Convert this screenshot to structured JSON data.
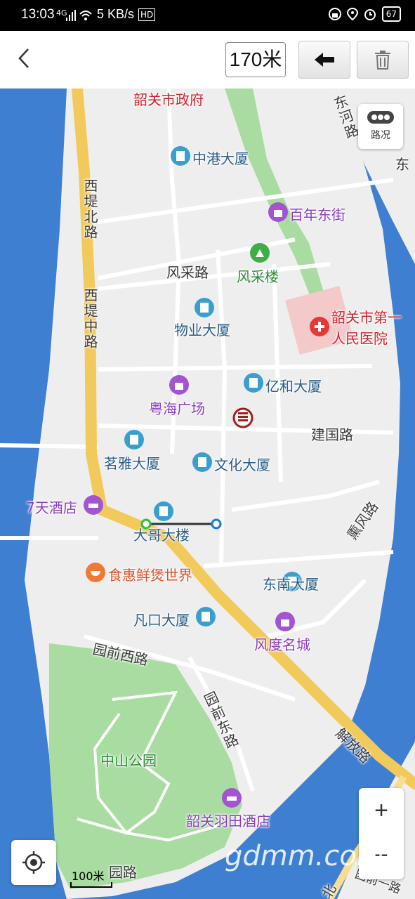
{
  "status_bar": {
    "time": "13:03",
    "network": "4G",
    "speed": "5 KB/s",
    "hd": "HD",
    "battery": "67"
  },
  "toolbar": {
    "distance": "170米"
  },
  "map_controls": {
    "traffic_label": "路况",
    "zoom_in": "+",
    "zoom_out": "−",
    "scale": "100米"
  },
  "watermark": "gdmm.com",
  "pois": {
    "shaoguan_gov": "韶关市政府",
    "zhonggang": "中港大厦",
    "bainian": "百年东街",
    "fengcai_lou": "风采楼",
    "wuye": "物业大厦",
    "hospital_line1": "韶关市第一",
    "hospital_line2": "人民医院",
    "yihe": "亿和大厦",
    "yuehai": "粤海广场",
    "mingya": "茗雅大厦",
    "wenhua": "文化大厦",
    "qitian": "7天酒店",
    "dage": "大哥大楼",
    "shihui": "食惠鲜煲世界",
    "dongnan": "东南大厦",
    "fankou": "凡口大厦",
    "fengdu": "风度名城",
    "zhongshan": "中山公园",
    "yutian": "韶关羽田酒店"
  },
  "roads": {
    "xidi_bei": "西堤北路",
    "xidi_zhong": "西堤中路",
    "fengcai_lu": "风采路",
    "jianguo": "建国路",
    "xunfeng": "熏风路",
    "yuanqian_xi": "园前西路",
    "yuanqian_dong": "园前东路",
    "jiefang": "解放路",
    "donghe": "东河路",
    "dong": "东",
    "yuanlu": "园路",
    "bei": "北",
    "yuanqian_yi": "园前一路"
  }
}
